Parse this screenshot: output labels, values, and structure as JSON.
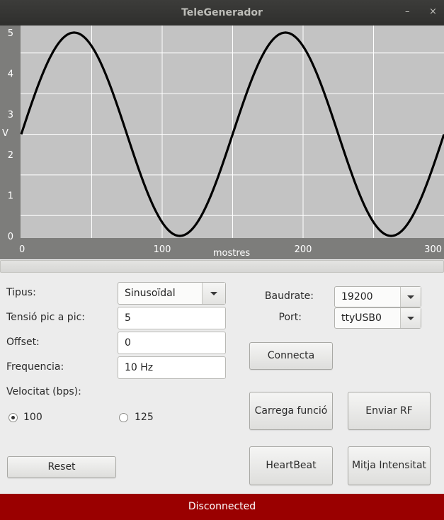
{
  "window": {
    "title": "TeleGenerador",
    "minimize_glyph": "–",
    "close_glyph": "×"
  },
  "chart_data": {
    "type": "line",
    "title": "",
    "xlabel": "mostres",
    "ylabel": "V",
    "xlim": [
      0,
      300
    ],
    "ylim": [
      0,
      5
    ],
    "x_ticks": [
      "0",
      "100",
      "200",
      "300"
    ],
    "y_ticks": [
      "0",
      "1",
      "2",
      "3",
      "4",
      "5"
    ],
    "grid": true,
    "series": [
      {
        "amplitude_pp": 5,
        "offset": 2.5,
        "period": 150,
        "color": "#000000",
        "samples_shown": 300
      }
    ]
  },
  "form": {
    "tipus_label": "Tipus:",
    "tipus_value": "Sinusoïdal",
    "tensio_label": "Tensió pic a pic:",
    "tensio_value": "5",
    "offset_label": "Offset:",
    "offset_value": "0",
    "freq_label": "Frequencia:",
    "freq_value": "10 Hz",
    "velocitat_label": "Velocitat (bps):",
    "radio_100": "100",
    "radio_125": "125",
    "reset": "Reset"
  },
  "serial": {
    "baud_label": "Baudrate:",
    "baud_value": "19200",
    "port_label": "Port:",
    "port_value": "ttyUSB0",
    "connect": "Connecta"
  },
  "actions": {
    "carrega": "Carrega funció",
    "enviar": "Enviar RF",
    "heartbeat": "HeartBeat",
    "mitja": "Mitja Intensitat"
  },
  "status": {
    "text": "Disconnected",
    "color": "#9a0000"
  }
}
